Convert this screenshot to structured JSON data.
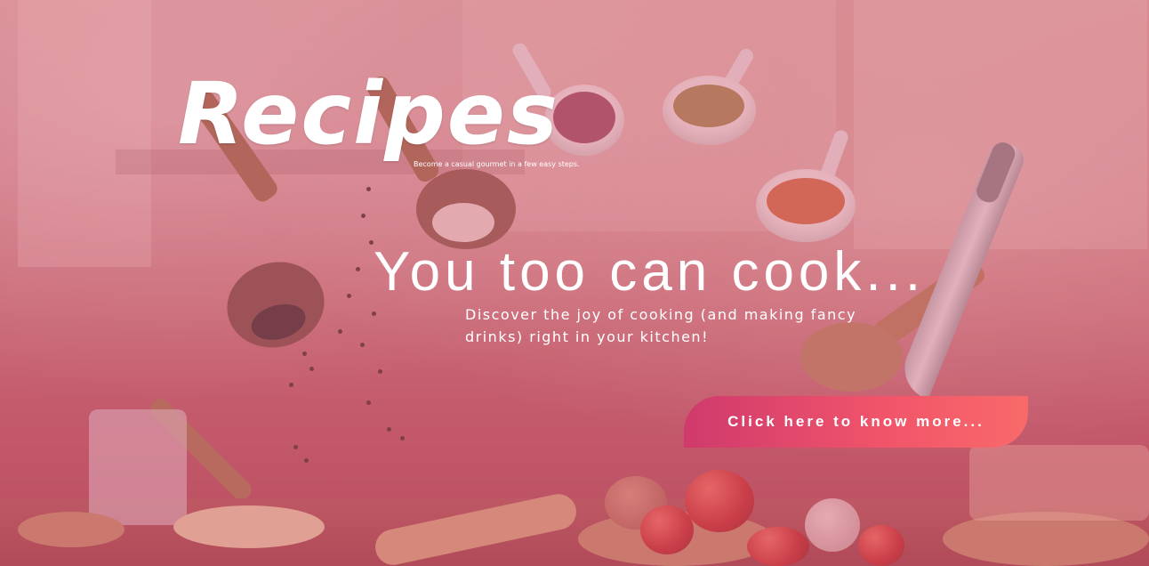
{
  "brand": {
    "title": "Recipes",
    "tagline": "Become a casual gourmet in a few easy steps."
  },
  "hero": {
    "headline": "You too can cook...",
    "subtext": "Discover the joy of cooking (and making fancy drinks) right in your kitchen!",
    "cta_label": "Click here to know more..."
  },
  "colors": {
    "overlay": "#d65f78",
    "cta_gradient_start": "#cf3a6c",
    "cta_gradient_end": "#f86a6a",
    "text": "#ffffff"
  }
}
